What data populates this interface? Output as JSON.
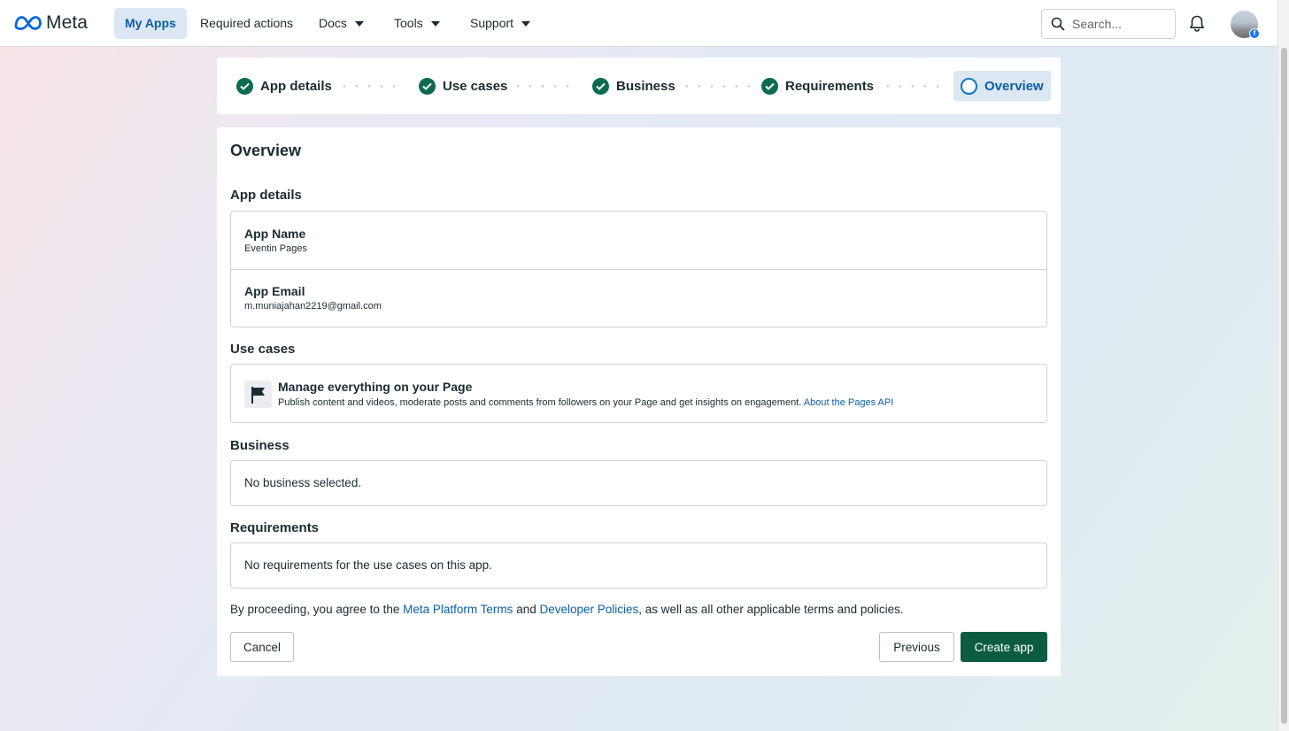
{
  "nav": {
    "logo_text": "Meta",
    "items": [
      {
        "label": "My Apps"
      },
      {
        "label": "Required actions"
      },
      {
        "label": "Docs"
      },
      {
        "label": "Tools"
      },
      {
        "label": "Support"
      }
    ],
    "search_placeholder": "Search...",
    "icons": {
      "search": "search-icon",
      "notifications": "bell-icon",
      "avatar_badge": "facebook-icon"
    }
  },
  "stepper": {
    "steps": [
      {
        "label": "App details",
        "status": "complete"
      },
      {
        "label": "Use cases",
        "status": "complete"
      },
      {
        "label": "Business",
        "status": "complete"
      },
      {
        "label": "Requirements",
        "status": "complete"
      },
      {
        "label": "Overview",
        "status": "current"
      }
    ]
  },
  "overview": {
    "title": "Overview",
    "app_details": {
      "heading": "App details",
      "app_name_label": "App Name",
      "app_name_value": "Eventin Pages",
      "app_email_label": "App Email",
      "app_email_value": "m.muniajahan2219@gmail.com"
    },
    "use_cases": {
      "heading": "Use cases",
      "items": [
        {
          "title": "Manage everything on your Page",
          "description": "Publish content and videos, moderate posts and comments from followers on your Page and get insights on engagement.",
          "link": "About the Pages API",
          "icon": "flag-icon"
        }
      ]
    },
    "business": {
      "heading": "Business",
      "text": "No business selected."
    },
    "requirements": {
      "heading": "Requirements",
      "text": "No requirements for the use cases on this app."
    },
    "terms": {
      "prefix": "By proceeding, you agree to the ",
      "link1": "Meta Platform Terms",
      "middle": " and ",
      "link2": "Developer Policies",
      "suffix": ", as well as all other applicable terms and policies."
    },
    "buttons": {
      "cancel": "Cancel",
      "previous": "Previous",
      "create": "Create app"
    }
  },
  "colors": {
    "accent_blue": "#0a5fa8",
    "complete_green": "#0b6b4f",
    "primary_button": "#0b5c43",
    "active_tab_bg": "#dbe7f2"
  }
}
